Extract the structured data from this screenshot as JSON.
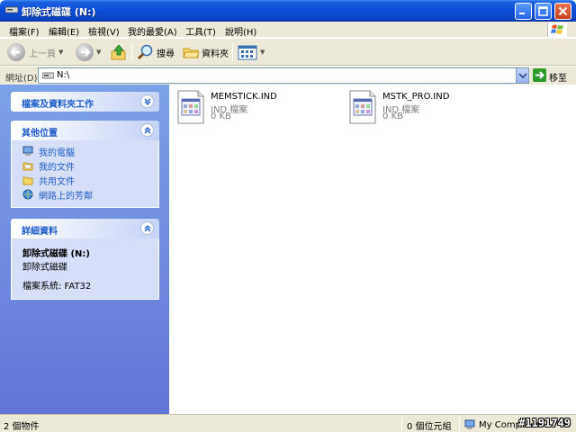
{
  "window": {
    "title": "卸除式磁碟 (N:)"
  },
  "menu": {
    "items": [
      "檔案(F)",
      "編輯(E)",
      "檢視(V)",
      "我的最愛(A)",
      "工具(T)",
      "說明(H)"
    ]
  },
  "toolbar": {
    "back_label": "上一頁",
    "search_label": "搜尋",
    "folders_label": "資料夾"
  },
  "address": {
    "label": "網址(D)",
    "value": "N:\\",
    "go_label": "移至"
  },
  "sidebar": {
    "tasks": {
      "title": "檔案及資料夾工作"
    },
    "places": {
      "title": "其他位置",
      "items": [
        {
          "label": "我的電腦",
          "icon": "my-computer-icon"
        },
        {
          "label": "我的文件",
          "icon": "my-documents-icon"
        },
        {
          "label": "共用文件",
          "icon": "shared-folder-icon"
        },
        {
          "label": "網路上的芳鄰",
          "icon": "network-places-icon"
        }
      ]
    },
    "details": {
      "title": "詳細資料",
      "name": "卸除式磁碟 (N:)",
      "type": "卸除式磁碟",
      "filesystem": "檔案系統: FAT32"
    }
  },
  "files": [
    {
      "name": "MEMSTICK.IND",
      "type": "IND 檔案",
      "size": "0 KB"
    },
    {
      "name": "MSTK_PRO.IND",
      "type": "IND 檔案",
      "size": "0 KB"
    }
  ],
  "status": {
    "objects": "2 個物件",
    "size": "0 個位元組",
    "zone": "My Computer"
  },
  "watermark": "#1191749",
  "colors": {
    "title_blue": "#0a4bd6",
    "sidebar_blue": "#7ba2e7",
    "link_blue": "#215dc6"
  }
}
